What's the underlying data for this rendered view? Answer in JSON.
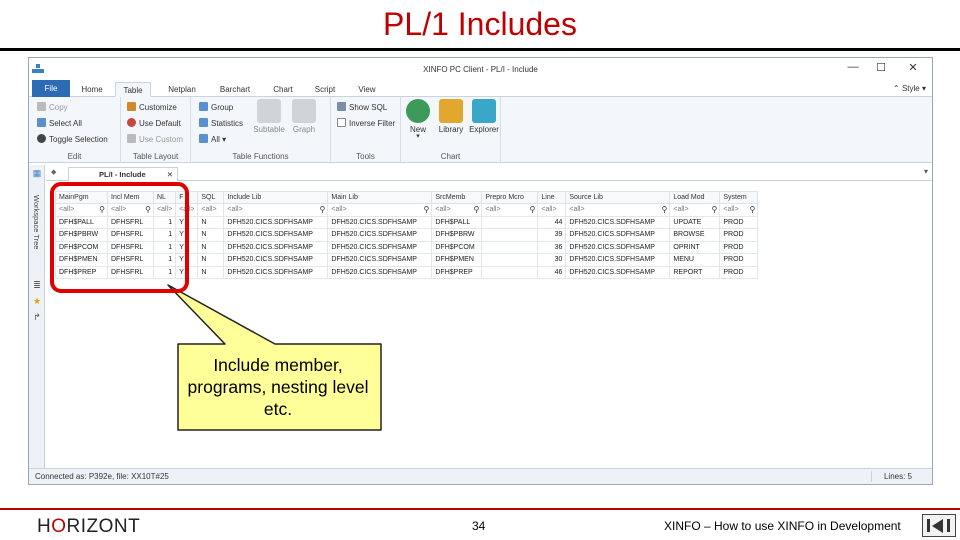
{
  "slide": {
    "title": "PL/1 Includes",
    "logo_prefix": "H",
    "logo_o": "O",
    "logo_suffix": "RIZONT",
    "page_number": "34",
    "footer": "XINFO – How to use XINFO in Development",
    "accent_color": "#c00000"
  },
  "window": {
    "title": "XINFO PC Client - PL/I - Include",
    "controls": [
      "—",
      "☐",
      "✕"
    ]
  },
  "menu": {
    "tabs": [
      "File",
      "Home",
      "Table",
      "Netplan",
      "Barchart",
      "Chart",
      "Script",
      "View"
    ],
    "active_tab": "Table",
    "style_label": "Style"
  },
  "ribbon": {
    "edit": {
      "label": "Edit",
      "items": [
        "Copy",
        "Select All",
        "Toggle Selection"
      ]
    },
    "layout": {
      "label": "Table Layout",
      "items": [
        "Customize",
        "Use Default",
        "Use Custom"
      ]
    },
    "functions": {
      "label": "Table Functions",
      "items": [
        "Group",
        "Statistics",
        "All"
      ],
      "subtable": "Subtable",
      "graph": "Graph"
    },
    "tools": {
      "label": "Tools",
      "items": [
        "Show SQL",
        "Inverse Filter"
      ]
    },
    "chart": {
      "label": "Chart",
      "new": "New",
      "library": "Library",
      "explorer": "Explorer"
    }
  },
  "sidebar": {
    "label": "Workspace Tree"
  },
  "doc_tab": {
    "label": "PL/I - Include",
    "close": "✕"
  },
  "table": {
    "columns": [
      "MainPgm",
      "Incl Mem",
      "NL",
      "F",
      "SQL",
      "Include Lib",
      "Main Lib",
      "SrcMemb",
      "Prepro Mcro",
      "Line",
      "Source Lib",
      "Load Mod",
      "System"
    ],
    "filter_placeholder": "<all>",
    "rows": [
      [
        "DFH$PALL",
        "DFHSFRL",
        "1",
        "Y",
        "N",
        "DFH520.CICS.SDFHSAMP",
        "DFH520.CICS.SDFHSAMP",
        "DFH$PALL",
        "",
        "44",
        "DFH520.CICS.SDFHSAMP",
        "UPDATE",
        "PROD"
      ],
      [
        "DFH$PBRW",
        "DFHSFRL",
        "1",
        "Y",
        "N",
        "DFH520.CICS.SDFHSAMP",
        "DFH520.CICS.SDFHSAMP",
        "DFH$PBRW",
        "",
        "39",
        "DFH520.CICS.SDFHSAMP",
        "BROWSE",
        "PROD"
      ],
      [
        "DFH$PCOM",
        "DFHSFRL",
        "1",
        "Y",
        "N",
        "DFH520.CICS.SDFHSAMP",
        "DFH520.CICS.SDFHSAMP",
        "DFH$PCOM",
        "",
        "36",
        "DFH520.CICS.SDFHSAMP",
        "OPRINT",
        "PROD"
      ],
      [
        "DFH$PMEN",
        "DFHSFRL",
        "1",
        "Y",
        "N",
        "DFH520.CICS.SDFHSAMP",
        "DFH520.CICS.SDFHSAMP",
        "DFH$PMEN",
        "",
        "30",
        "DFH520.CICS.SDFHSAMP",
        "MENU",
        "PROD"
      ],
      [
        "DFH$PREP",
        "DFHSFRL",
        "1",
        "Y",
        "N",
        "DFH520.CICS.SDFHSAMP",
        "DFH520.CICS.SDFHSAMP",
        "DFH$PREP",
        "",
        "46",
        "DFH520.CICS.SDFHSAMP",
        "REPORT",
        "PROD"
      ]
    ]
  },
  "status": {
    "connection": "Connected as: P392e, file: XX10T#25",
    "lines": "Lines: 5"
  },
  "callout": {
    "text": "Include member, programs, nesting level etc.",
    "fill_color": "#ffff99",
    "highlight_color": "#e00000"
  }
}
